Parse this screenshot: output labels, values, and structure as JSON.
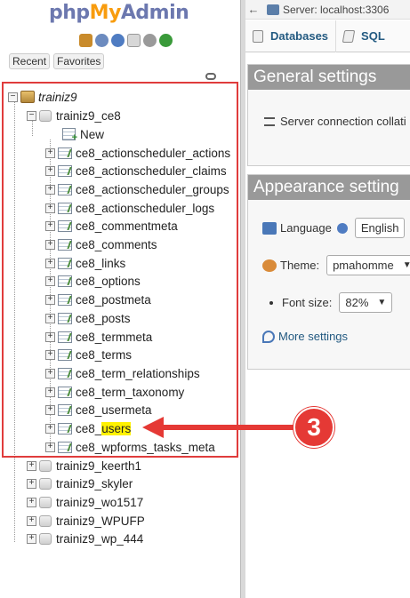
{
  "nav": {
    "logo_php": "php",
    "logo_my": "My",
    "logo_admin": "Admin",
    "recent_label": "Recent",
    "favorites_label": "Favorites",
    "server_node": "trainiz9",
    "database_open": "trainiz9_ce8",
    "new_label": "New",
    "tables": [
      "ce8_actionscheduler_actions",
      "ce8_actionscheduler_claims",
      "ce8_actionscheduler_groups",
      "ce8_actionscheduler_logs",
      "ce8_commentmeta",
      "ce8_comments",
      "ce8_links",
      "ce8_options",
      "ce8_postmeta",
      "ce8_posts",
      "ce8_termmeta",
      "ce8_terms",
      "ce8_term_relationships",
      "ce8_term_taxonomy",
      "ce8_usermeta",
      "ce8_",
      "ce8_wpforms_tasks_meta"
    ],
    "highlight_suffix": "users",
    "other_databases": [
      "trainiz9_keerth1",
      "trainiz9_skyler",
      "trainiz9_wo1517",
      "trainiz9_WPUFP",
      "trainiz9_wp_444"
    ]
  },
  "annotation": {
    "step_number": "3",
    "accent_color": "#e53935"
  },
  "right": {
    "server_label": "Server: localhost:3306",
    "tab_databases": "Databases",
    "tab_sql": "SQL",
    "general_heading": "General settings",
    "server_collation": "Server connection collati",
    "appearance_heading": "Appearance setting",
    "language_label": "Language",
    "language_value": "English",
    "theme_label": "Theme:",
    "theme_value": "pmahomme",
    "font_size_label": "Font size:",
    "font_size_value": "82%",
    "more_settings": "More settings"
  }
}
